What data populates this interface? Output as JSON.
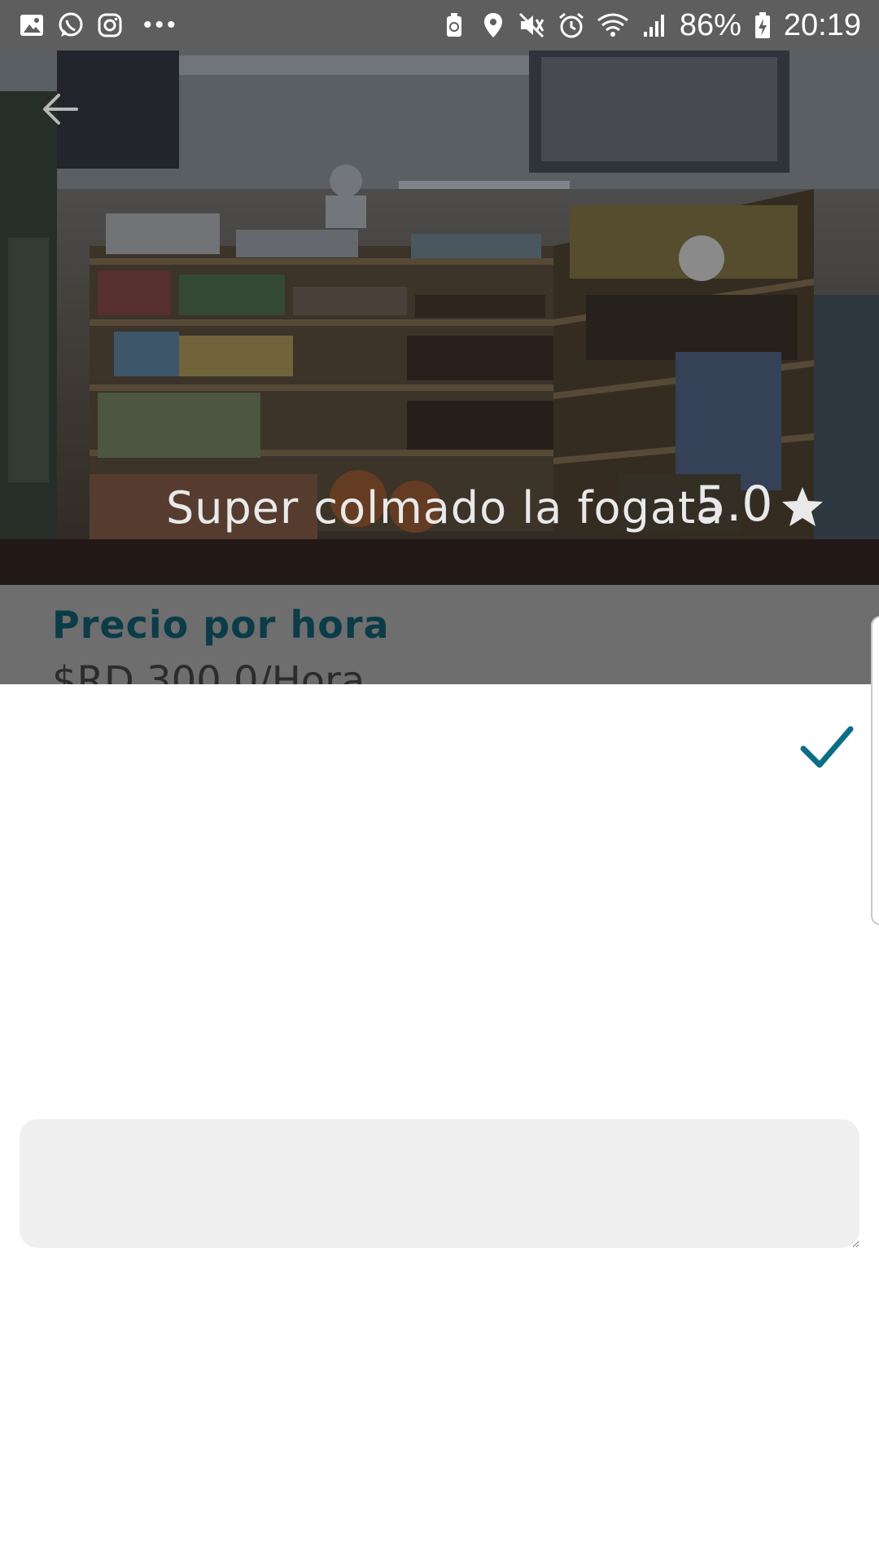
{
  "status_bar": {
    "battery_percent": "86%",
    "time": "20:19",
    "more_indicator": "•••",
    "left_icons": [
      "gallery-icon",
      "whatsapp-icon",
      "instagram-icon"
    ],
    "right_icons": [
      "battery-saver-icon",
      "location-icon",
      "mute-icon",
      "alarm-icon",
      "wifi-icon",
      "signal-icon",
      "battery-charging-icon"
    ]
  },
  "hero": {
    "title": "Super colmado la fogata",
    "rating": "5.0",
    "star_icon": "star-icon",
    "back_icon": "arrow-left-icon"
  },
  "details": {
    "price_heading": "Precio por hora",
    "price_value": "$RD 300.0/Hora"
  },
  "sheet": {
    "confirm_icon": "checkmark-icon",
    "text_input_value": ""
  },
  "colors": {
    "accent": "#0b6e86",
    "price_heading": "#0b3c48",
    "input_background": "#efefef",
    "status_bar": "#5e5e5e",
    "scrim_over_content": "#6e6e6e"
  }
}
